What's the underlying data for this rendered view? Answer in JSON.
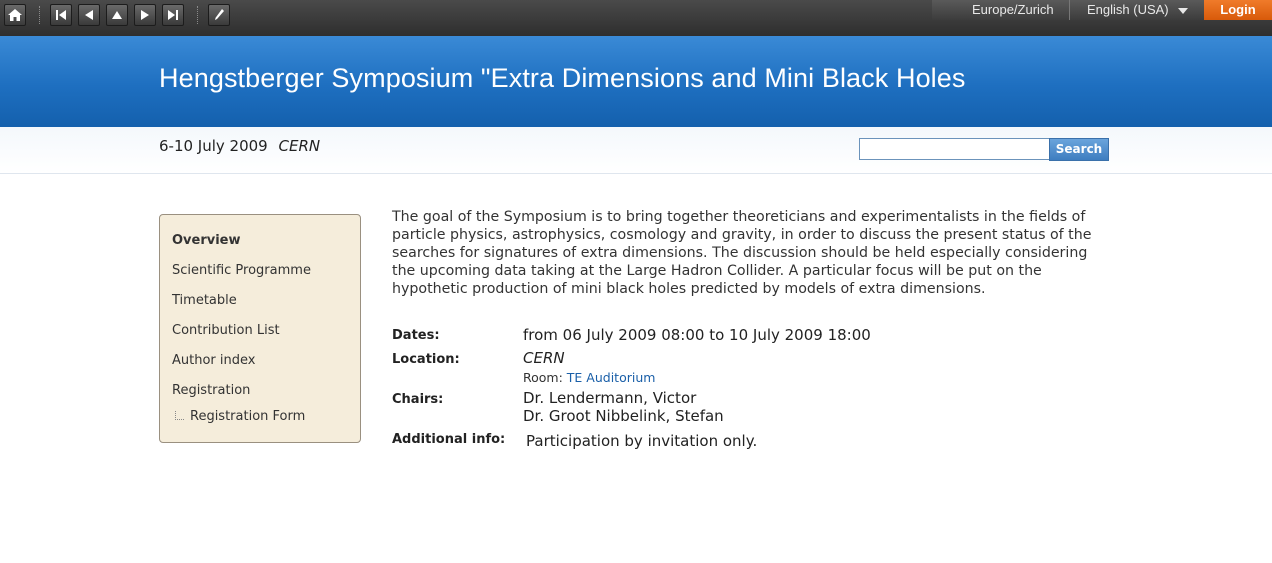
{
  "toolbar": {
    "timezone": "Europe/Zurich",
    "language": "English (USA)",
    "login": "Login"
  },
  "event": {
    "title": "Hengstberger Symposium \"Extra Dimensions and Mini Black Holes",
    "date_range": "6-10 July 2009",
    "location_short": "CERN"
  },
  "search": {
    "placeholder": "",
    "button": "Search"
  },
  "menu": {
    "items": [
      {
        "label": "Overview"
      },
      {
        "label": "Scientific Programme"
      },
      {
        "label": "Timetable"
      },
      {
        "label": "Contribution List"
      },
      {
        "label": "Author index"
      },
      {
        "label": "Registration"
      },
      {
        "label": "Registration Form"
      }
    ]
  },
  "description": "The goal of the Symposium is to bring together theoreticians and experimentalists in the fields of particle physics, astrophysics, cosmology and gravity, in order to discuss the present status of the searches for signatures of extra dimensions. The discussion should be held especially considering the upcoming data taking at the Large Hadron Collider. A particular focus will be put on the hypothetic production of mini black holes predicted by models of extra dimensions.",
  "details": {
    "dates_label": "Dates:",
    "dates_value": "from 06 July 2009 08:00 to 10 July 2009 18:00",
    "location_label": "Location:",
    "location_value": "CERN",
    "room_label": "Room:",
    "room_value": "TE Auditorium",
    "chairs_label": "Chairs:",
    "chairs": [
      "Dr. Lendermann, Victor",
      "Dr. Groot Nibbelink, Stefan"
    ],
    "info_label": "Additional info:",
    "info_value": "Participation by invitation only."
  },
  "colors": {
    "banner": "#1e6fc0",
    "login": "#e86a18",
    "menu_bg": "#f5eddb",
    "link": "#1a5fa8"
  }
}
